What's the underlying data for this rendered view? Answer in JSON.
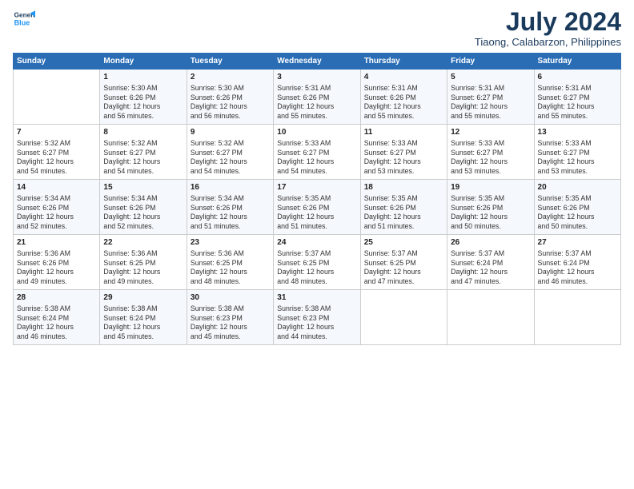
{
  "header": {
    "logo_line1": "General",
    "logo_line2": "Blue",
    "title": "July 2024",
    "subtitle": "Tiaong, Calabarzon, Philippines"
  },
  "days_header": [
    "Sunday",
    "Monday",
    "Tuesday",
    "Wednesday",
    "Thursday",
    "Friday",
    "Saturday"
  ],
  "weeks": [
    [
      {
        "num": "",
        "info": ""
      },
      {
        "num": "1",
        "info": "Sunrise: 5:30 AM\nSunset: 6:26 PM\nDaylight: 12 hours\nand 56 minutes."
      },
      {
        "num": "2",
        "info": "Sunrise: 5:30 AM\nSunset: 6:26 PM\nDaylight: 12 hours\nand 56 minutes."
      },
      {
        "num": "3",
        "info": "Sunrise: 5:31 AM\nSunset: 6:26 PM\nDaylight: 12 hours\nand 55 minutes."
      },
      {
        "num": "4",
        "info": "Sunrise: 5:31 AM\nSunset: 6:26 PM\nDaylight: 12 hours\nand 55 minutes."
      },
      {
        "num": "5",
        "info": "Sunrise: 5:31 AM\nSunset: 6:27 PM\nDaylight: 12 hours\nand 55 minutes."
      },
      {
        "num": "6",
        "info": "Sunrise: 5:31 AM\nSunset: 6:27 PM\nDaylight: 12 hours\nand 55 minutes."
      }
    ],
    [
      {
        "num": "7",
        "info": "Sunrise: 5:32 AM\nSunset: 6:27 PM\nDaylight: 12 hours\nand 54 minutes."
      },
      {
        "num": "8",
        "info": "Sunrise: 5:32 AM\nSunset: 6:27 PM\nDaylight: 12 hours\nand 54 minutes."
      },
      {
        "num": "9",
        "info": "Sunrise: 5:32 AM\nSunset: 6:27 PM\nDaylight: 12 hours\nand 54 minutes."
      },
      {
        "num": "10",
        "info": "Sunrise: 5:33 AM\nSunset: 6:27 PM\nDaylight: 12 hours\nand 54 minutes."
      },
      {
        "num": "11",
        "info": "Sunrise: 5:33 AM\nSunset: 6:27 PM\nDaylight: 12 hours\nand 53 minutes."
      },
      {
        "num": "12",
        "info": "Sunrise: 5:33 AM\nSunset: 6:27 PM\nDaylight: 12 hours\nand 53 minutes."
      },
      {
        "num": "13",
        "info": "Sunrise: 5:33 AM\nSunset: 6:27 PM\nDaylight: 12 hours\nand 53 minutes."
      }
    ],
    [
      {
        "num": "14",
        "info": "Sunrise: 5:34 AM\nSunset: 6:26 PM\nDaylight: 12 hours\nand 52 minutes."
      },
      {
        "num": "15",
        "info": "Sunrise: 5:34 AM\nSunset: 6:26 PM\nDaylight: 12 hours\nand 52 minutes."
      },
      {
        "num": "16",
        "info": "Sunrise: 5:34 AM\nSunset: 6:26 PM\nDaylight: 12 hours\nand 51 minutes."
      },
      {
        "num": "17",
        "info": "Sunrise: 5:35 AM\nSunset: 6:26 PM\nDaylight: 12 hours\nand 51 minutes."
      },
      {
        "num": "18",
        "info": "Sunrise: 5:35 AM\nSunset: 6:26 PM\nDaylight: 12 hours\nand 51 minutes."
      },
      {
        "num": "19",
        "info": "Sunrise: 5:35 AM\nSunset: 6:26 PM\nDaylight: 12 hours\nand 50 minutes."
      },
      {
        "num": "20",
        "info": "Sunrise: 5:35 AM\nSunset: 6:26 PM\nDaylight: 12 hours\nand 50 minutes."
      }
    ],
    [
      {
        "num": "21",
        "info": "Sunrise: 5:36 AM\nSunset: 6:26 PM\nDaylight: 12 hours\nand 49 minutes."
      },
      {
        "num": "22",
        "info": "Sunrise: 5:36 AM\nSunset: 6:25 PM\nDaylight: 12 hours\nand 49 minutes."
      },
      {
        "num": "23",
        "info": "Sunrise: 5:36 AM\nSunset: 6:25 PM\nDaylight: 12 hours\nand 48 minutes."
      },
      {
        "num": "24",
        "info": "Sunrise: 5:37 AM\nSunset: 6:25 PM\nDaylight: 12 hours\nand 48 minutes."
      },
      {
        "num": "25",
        "info": "Sunrise: 5:37 AM\nSunset: 6:25 PM\nDaylight: 12 hours\nand 47 minutes."
      },
      {
        "num": "26",
        "info": "Sunrise: 5:37 AM\nSunset: 6:24 PM\nDaylight: 12 hours\nand 47 minutes."
      },
      {
        "num": "27",
        "info": "Sunrise: 5:37 AM\nSunset: 6:24 PM\nDaylight: 12 hours\nand 46 minutes."
      }
    ],
    [
      {
        "num": "28",
        "info": "Sunrise: 5:38 AM\nSunset: 6:24 PM\nDaylight: 12 hours\nand 46 minutes."
      },
      {
        "num": "29",
        "info": "Sunrise: 5:38 AM\nSunset: 6:24 PM\nDaylight: 12 hours\nand 45 minutes."
      },
      {
        "num": "30",
        "info": "Sunrise: 5:38 AM\nSunset: 6:23 PM\nDaylight: 12 hours\nand 45 minutes."
      },
      {
        "num": "31",
        "info": "Sunrise: 5:38 AM\nSunset: 6:23 PM\nDaylight: 12 hours\nand 44 minutes."
      },
      {
        "num": "",
        "info": ""
      },
      {
        "num": "",
        "info": ""
      },
      {
        "num": "",
        "info": ""
      }
    ]
  ]
}
